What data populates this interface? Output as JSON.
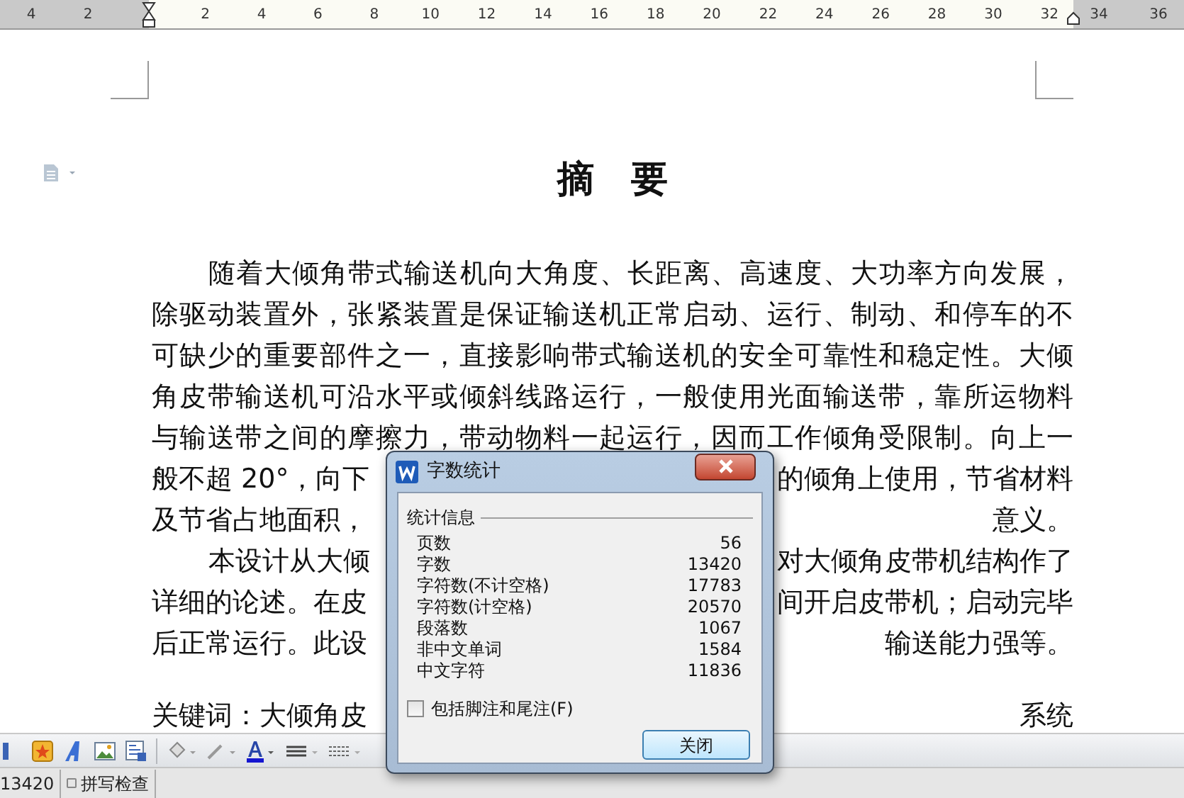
{
  "ruler": {
    "left_labels": [
      "4",
      "2"
    ],
    "labels": [
      "2",
      "4",
      "6",
      "8",
      "10",
      "12",
      "14",
      "16",
      "18",
      "20",
      "22",
      "24",
      "26",
      "28",
      "30",
      "32"
    ],
    "right_labels": [
      "34",
      "36"
    ]
  },
  "document": {
    "title": "摘　要",
    "lines": [
      {
        "kind": "full",
        "indent": true,
        "text": "随着大倾角带式输送机向大角度、长距离、高速度、大功率方向发展，"
      },
      {
        "kind": "full",
        "indent": false,
        "text": "除驱动装置外，张紧装置是保证输送机正常启动、运行、制动、和停车的不"
      },
      {
        "kind": "full",
        "indent": false,
        "text": "可缺少的重要部件之一，直接影响带式输送机的安全可靠性和稳定性。大倾"
      },
      {
        "kind": "full",
        "indent": false,
        "text": "角皮带输送机可沿水平或倾斜线路运行，一般使用光面输送带，靠所运物料"
      },
      {
        "kind": "full",
        "indent": false,
        "text": "与输送带之间的摩擦力，带动物料一起运行，因而工作倾角受限制。向上一"
      },
      {
        "kind": "split",
        "indent": false,
        "left": "般不超 20°，向下",
        "right": "的倾角上使用，节省材料"
      },
      {
        "kind": "split",
        "indent": false,
        "left": "及节省占地面积，",
        "right": "意义。"
      },
      {
        "kind": "split",
        "indent": true,
        "left": "本设计从大倾",
        "right": "对大倾角皮带机结构作了"
      },
      {
        "kind": "split",
        "indent": false,
        "left": "详细的论述。在皮",
        "right": "间开启皮带机；启动完毕"
      },
      {
        "kind": "split",
        "indent": false,
        "left": "后正常运行。此设",
        "right": "输送能力强等。"
      },
      {
        "kind": "blank"
      },
      {
        "kind": "split",
        "indent": false,
        "left": "关键词：大倾角皮",
        "right": "系统"
      }
    ]
  },
  "dialog": {
    "title": "字数统计",
    "group_label": "统计信息",
    "stats": [
      {
        "label": "页数",
        "value": "56"
      },
      {
        "label": "字数",
        "value": "13420"
      },
      {
        "label": "字符数(不计空格)",
        "value": "17783"
      },
      {
        "label": "字符数(计空格)",
        "value": "20570"
      },
      {
        "label": "段落数",
        "value": "1067"
      },
      {
        "label": "非中文单词",
        "value": "1584"
      },
      {
        "label": "中文字符",
        "value": "11836"
      }
    ],
    "checkbox": {
      "label": "包括脚注和尾注(F)",
      "checked": false
    },
    "button": "关闭"
  },
  "status_bar": {
    "word_count": "13420",
    "spell_check": "拼写检查"
  }
}
